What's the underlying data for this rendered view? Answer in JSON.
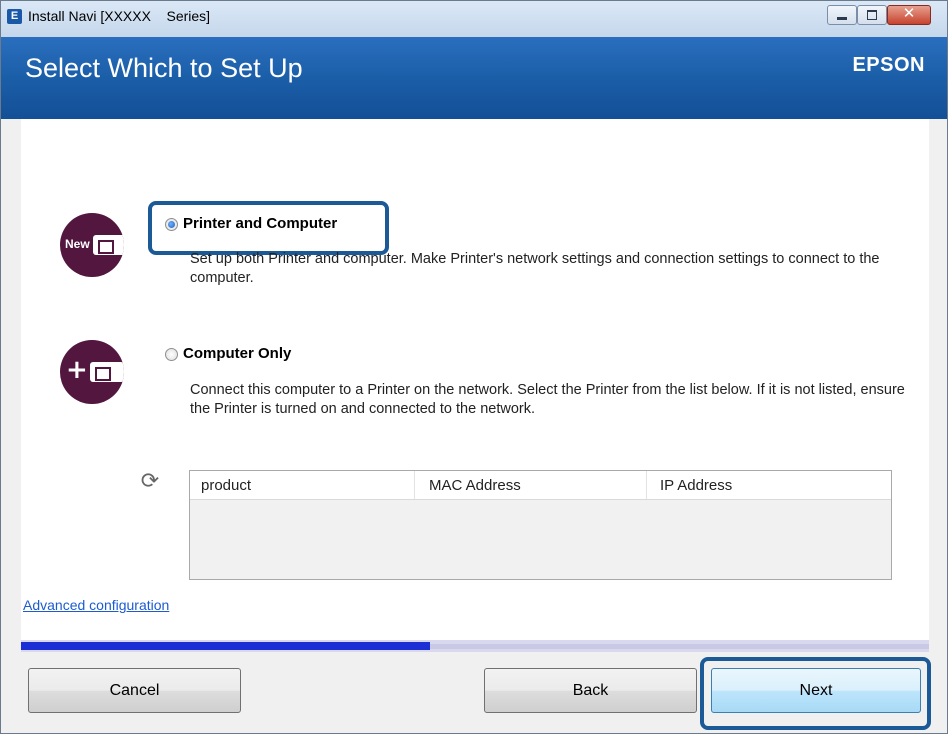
{
  "window": {
    "title": "Install Navi [XXXXX    Series]",
    "icon_letter": "E"
  },
  "header": {
    "heading": "Select Which to Set Up",
    "brand": "EPSON"
  },
  "options": [
    {
      "label": "Printer and Computer",
      "description": "Set up both Printer and computer. Make Printer's network settings and connection settings to connect to the computer.",
      "selected": true,
      "icon": "new-printer-icon",
      "icon_text": "New"
    },
    {
      "label": "Computer Only",
      "description": "Connect this computer to a Printer on the network. Select the Printer from the list below. If it is not listed, ensure the Printer is turned on and connected to the network.",
      "selected": false,
      "icon": "add-printer-icon"
    }
  ],
  "printer_table": {
    "columns": [
      "product",
      "MAC Address",
      "IP Address"
    ],
    "rows": []
  },
  "links": {
    "advanced": "Advanced configuration"
  },
  "progress": {
    "fraction": 0.45
  },
  "buttons": {
    "cancel": "Cancel",
    "back": "Back",
    "next": "Next"
  },
  "colors": {
    "header_blue": "#1b5ea8",
    "icon_circle": "#52163f",
    "highlight_border": "#1b5a96",
    "progress_fill": "#1c2fd4",
    "link": "#1d5bd0"
  }
}
